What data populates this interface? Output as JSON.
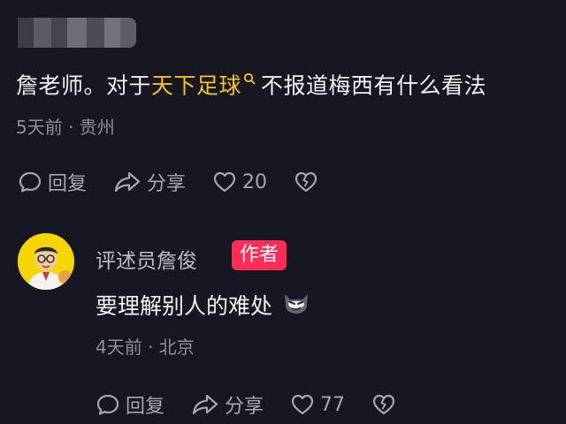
{
  "comment": {
    "text_before": "詹老师。对于",
    "highlight": "天下足球",
    "search_icon": "search-icon",
    "text_after": "不报道梅西有什么看法",
    "meta": "5天前 · 贵州",
    "actions": {
      "reply_label": "回复",
      "share_label": "分享",
      "like_count": "20"
    }
  },
  "reply": {
    "author": "评述员詹俊",
    "badge": "作者",
    "text": "要理解别人的难处",
    "emoji": "cat-smirk-emoji",
    "meta": "4天前 · 北京",
    "actions": {
      "reply_label": "回复",
      "share_label": "分享",
      "like_count": "77"
    }
  },
  "colors": {
    "background": "#161722",
    "highlight": "#F5C518",
    "badge": "#FF2D55",
    "avatar_bg": "#F7D500"
  }
}
